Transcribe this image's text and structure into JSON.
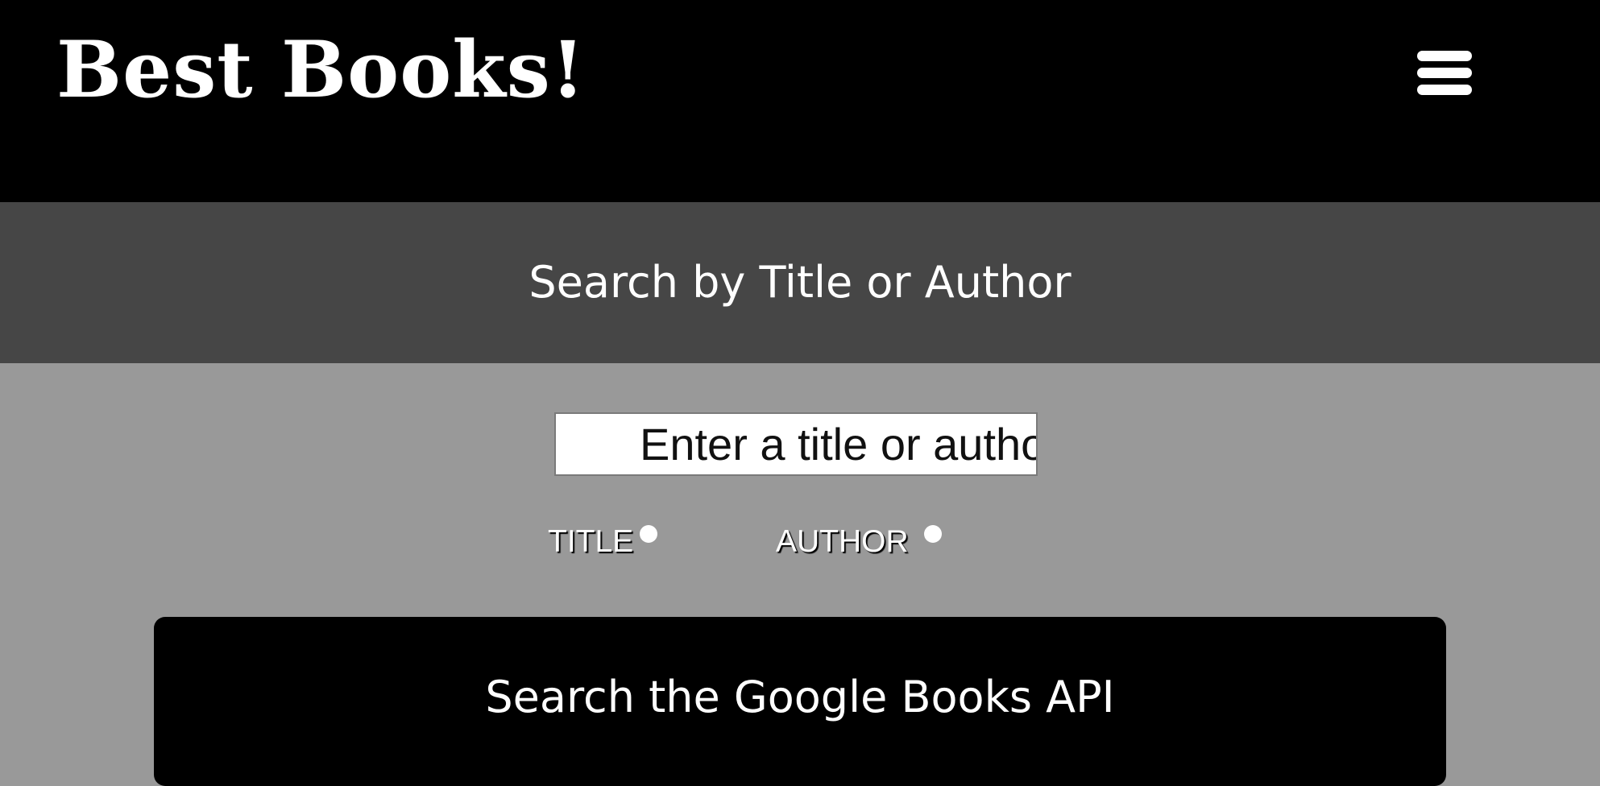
{
  "header": {
    "site_title": "Best Books!",
    "menu_icon": "hamburger-menu-icon"
  },
  "search": {
    "heading": "Search by Title or Author",
    "input_placeholder": "Enter a title or autho",
    "input_value": "",
    "options": [
      {
        "label": "TITLE"
      },
      {
        "label": "AUTHOR"
      }
    ],
    "submit_label": "Search the Google Books API"
  },
  "colors": {
    "header_background": "#000000",
    "search_header_background": "#464646",
    "page_background": "#999999",
    "button_background": "#000000",
    "text": "#ffffff"
  }
}
